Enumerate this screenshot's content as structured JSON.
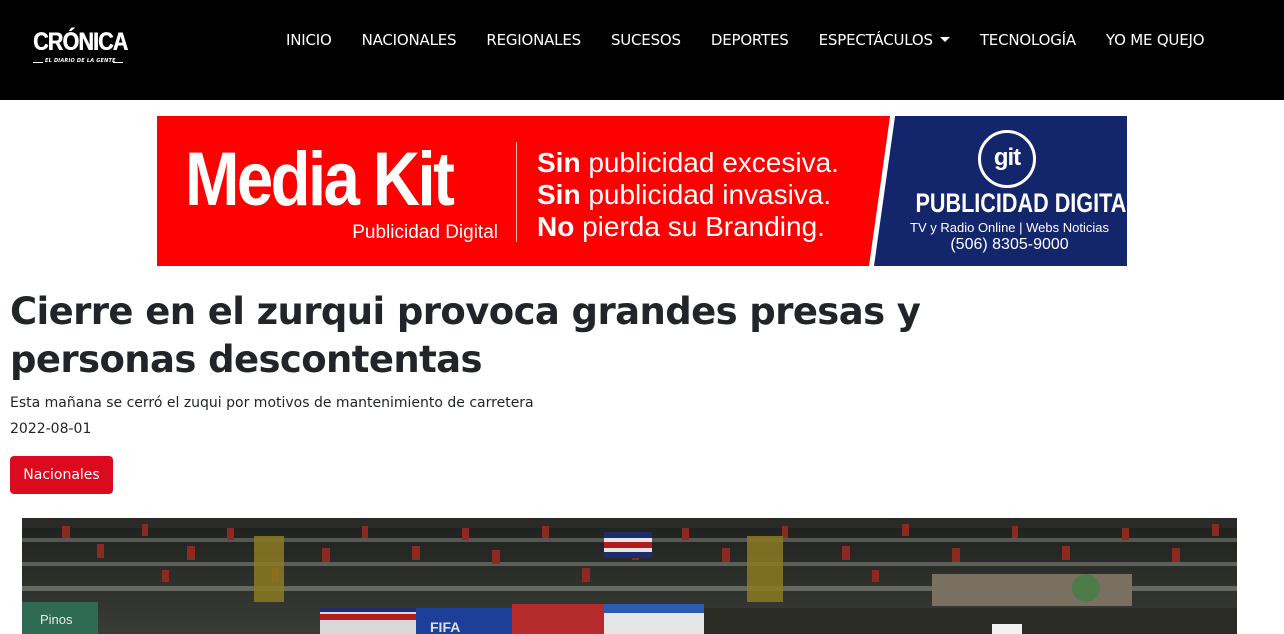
{
  "header": {
    "brand": {
      "name": "CRÓNICA",
      "tagline": "EL DIARIO DE LA GENTE"
    },
    "nav": [
      {
        "label": "INICIO"
      },
      {
        "label": "NACIONALES"
      },
      {
        "label": "REGIONALES"
      },
      {
        "label": "SUCESOS"
      },
      {
        "label": "DEPORTES"
      },
      {
        "label": "ESPECTÁCULOS",
        "has_dropdown": true
      },
      {
        "label": "TECNOLOGÍA"
      },
      {
        "label": "YO ME QUEJO"
      }
    ]
  },
  "ad": {
    "title": "Media Kit",
    "subtitle": "Publicidad Digital",
    "lines": [
      {
        "bold": "Sin",
        "rest": " publicidad excesiva."
      },
      {
        "bold": "Sin",
        "rest": " publicidad invasiva."
      },
      {
        "bold": "No",
        "rest": " pierda su Branding."
      }
    ],
    "logo": "git",
    "company": "PUBLICIDAD DIGITAL",
    "services": "TV y Radio Online | Webs Noticias",
    "phone": "(506) 8305-9000",
    "colors": {
      "red": "#fe0000",
      "navy": "#13256b"
    }
  },
  "article": {
    "title": "Cierre en el zurqui provoca grandes presas y personas descontentas",
    "summary": "Esta mañana se cerró el zuqui por motivos de mantenimiento de carretera",
    "date": "2022-08-01",
    "category": "Nacionales",
    "category_color": "#dc0a1e"
  },
  "hero_image": {
    "signage": [
      "Pinos",
      "FIFA"
    ]
  }
}
